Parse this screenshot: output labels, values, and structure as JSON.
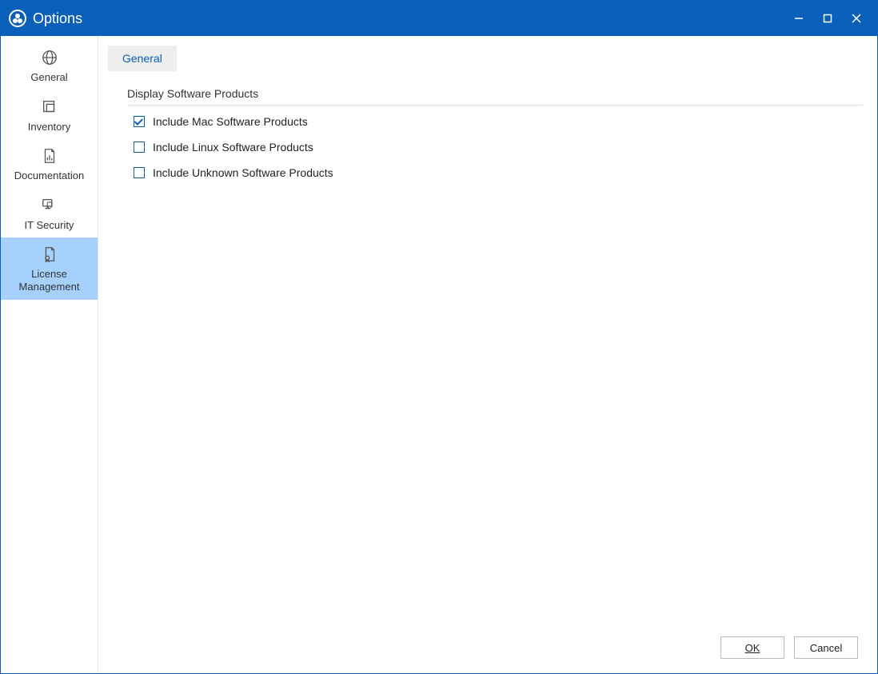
{
  "window": {
    "title": "Options"
  },
  "sidebar": {
    "items": [
      {
        "label": "General"
      },
      {
        "label": "Inventory"
      },
      {
        "label": "Documentation"
      },
      {
        "label": "IT Security"
      },
      {
        "label": "License Management"
      }
    ],
    "selected_index": 4
  },
  "tabs": {
    "items": [
      {
        "label": "General"
      }
    ],
    "active_index": 0
  },
  "section": {
    "title": "Display Software Products",
    "options": [
      {
        "label": "Include Mac Software Products",
        "checked": true
      },
      {
        "label": "Include Linux Software Products",
        "checked": false
      },
      {
        "label": "Include Unknown Software Products",
        "checked": false
      }
    ]
  },
  "buttons": {
    "ok": "OK",
    "cancel": "Cancel"
  }
}
